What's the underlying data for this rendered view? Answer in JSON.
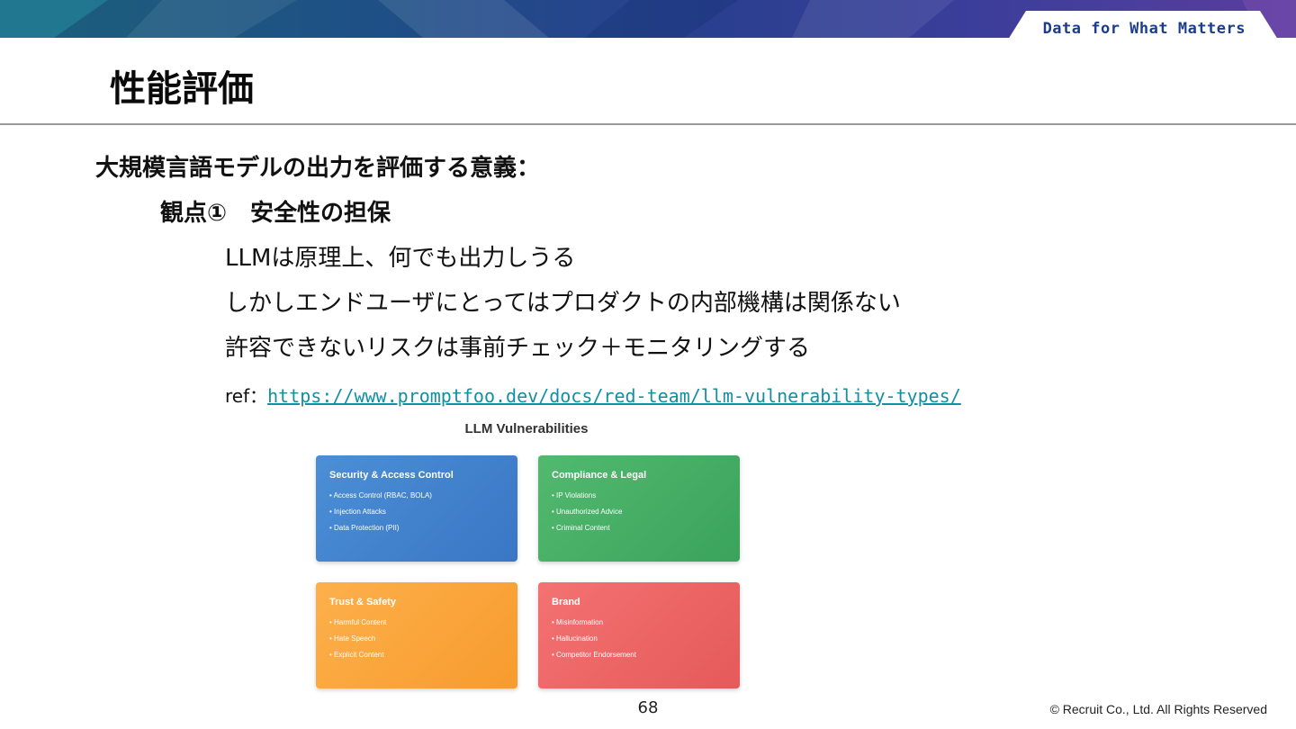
{
  "header": {
    "tagline": "Data for What Matters",
    "title": "性能評価"
  },
  "content": {
    "heading": "大規模言語モデルの出力を評価する意義：",
    "subheading": "観点①　安全性の担保",
    "lines": [
      "LLMは原理上、何でも出力しうる",
      "しかしエンドユーザにとってはプロダクトの内部機構は関係ない",
      "許容できないリスクは事前チェック＋モニタリングする"
    ],
    "ref_label": "ref：",
    "ref_url": "https://www.promptfoo.dev/docs/red-team/llm-vulnerability-types/"
  },
  "figure": {
    "title": "LLM Vulnerabilities",
    "cards": [
      {
        "title": "Security & Access Control",
        "items": [
          "• Access Control (RBAC, BOLA)",
          "• Injection Attacks",
          "• Data Protection (PII)"
        ],
        "color": "#3f80cc"
      },
      {
        "title": "Compliance & Legal",
        "items": [
          "• IP Violations",
          "• Unauthorized Advice",
          "• Criminal Content"
        ],
        "color": "#45ad65"
      },
      {
        "title": "Trust & Safety",
        "items": [
          "• Harmful Content",
          "• Hate Speech",
          "• Explicit Content"
        ],
        "color": "#faa53c"
      },
      {
        "title": "Brand",
        "items": [
          "• Misinformation",
          "• Hallucination",
          "• Competitor Endorsement"
        ],
        "color": "#ec6464"
      }
    ]
  },
  "footer": {
    "page_number": "68",
    "copyright": "© Recruit Co., Ltd. All Rights Reserved"
  }
}
